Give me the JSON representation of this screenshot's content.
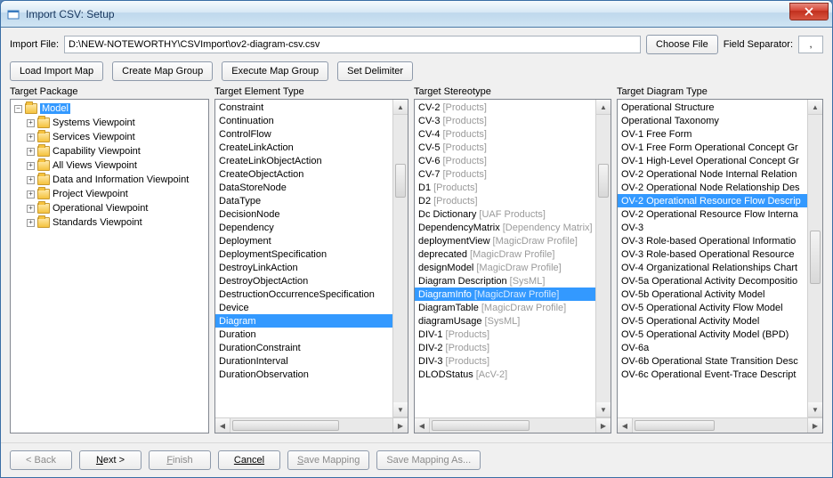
{
  "window": {
    "title": "Import CSV: Setup"
  },
  "import": {
    "label": "Import File:",
    "path": "D:\\NEW-NOTEWORTHY\\CSVImport\\ov2-diagram-csv.csv",
    "choose": "Choose File",
    "separator_label": "Field Separator:",
    "separator": ","
  },
  "buttons": {
    "load_map": "Load Import Map",
    "create_group": "Create Map Group",
    "exec_group": "Execute Map Group",
    "set_delim": "Set Delimiter"
  },
  "panels": {
    "p1": "Target Package",
    "p2": "Target Element Type",
    "p3": "Target Stereotype",
    "p4": "Target Diagram Type"
  },
  "tree": {
    "root": "Model",
    "children": [
      "Systems Viewpoint",
      "Services Viewpoint",
      "Capability Viewpoint",
      "All Views Viewpoint",
      "Data and Information Viewpoint",
      "Project Viewpoint",
      "Operational Viewpoint",
      "Standards Viewpoint"
    ]
  },
  "elementTypes": [
    "Constraint",
    "Continuation",
    "ControlFlow",
    "CreateLinkAction",
    "CreateLinkObjectAction",
    "CreateObjectAction",
    "DataStoreNode",
    "DataType",
    "DecisionNode",
    "Dependency",
    "Deployment",
    "DeploymentSpecification",
    "DestroyLinkAction",
    "DestroyObjectAction",
    "DestructionOccurrenceSpecification",
    "Device",
    "Diagram",
    "Duration",
    "DurationConstraint",
    "DurationInterval",
    "DurationObservation"
  ],
  "elementSelectedIndex": 16,
  "stereotypes": [
    {
      "label": "CV-2",
      "suffix": "[Products]"
    },
    {
      "label": "CV-3",
      "suffix": "[Products]"
    },
    {
      "label": "CV-4",
      "suffix": "[Products]"
    },
    {
      "label": "CV-5",
      "suffix": "[Products]"
    },
    {
      "label": "CV-6",
      "suffix": "[Products]"
    },
    {
      "label": "CV-7",
      "suffix": "[Products]"
    },
    {
      "label": "D1",
      "suffix": "[Products]"
    },
    {
      "label": "D2",
      "suffix": "[Products]"
    },
    {
      "label": "Dc Dictionary",
      "suffix": "[UAF Products]"
    },
    {
      "label": "DependencyMatrix",
      "suffix": "[Dependency Matrix]"
    },
    {
      "label": "deploymentView",
      "suffix": "[MagicDraw Profile]"
    },
    {
      "label": "deprecated",
      "suffix": "[MagicDraw Profile]"
    },
    {
      "label": "designModel",
      "suffix": "[MagicDraw Profile]"
    },
    {
      "label": "Diagram Description",
      "suffix": "[SysML]"
    },
    {
      "label": "DiagramInfo",
      "suffix": "[MagicDraw Profile]"
    },
    {
      "label": "DiagramTable",
      "suffix": "[MagicDraw Profile]"
    },
    {
      "label": "diagramUsage",
      "suffix": "[SysML]"
    },
    {
      "label": "DIV-1",
      "suffix": "[Products]"
    },
    {
      "label": "DIV-2",
      "suffix": "[Products]"
    },
    {
      "label": "DIV-3",
      "suffix": "[Products]"
    },
    {
      "label": "DLODStatus",
      "suffix": "[AcV-2]"
    }
  ],
  "stereoSelectedIndex": 14,
  "diagramTypes": [
    "Operational Structure",
    "Operational Taxonomy",
    "OV-1 Free Form",
    "OV-1 Free Form Operational Concept Gr",
    "OV-1 High-Level Operational Concept Gr",
    "OV-2 Operational Node Internal Relation",
    "OV-2 Operational Node Relationship Des",
    "OV-2 Operational Resource Flow Descrip",
    "OV-2 Operational Resource Flow Interna",
    "OV-3",
    "OV-3 Role-based Operational Informatio",
    "OV-3 Role-based Operational Resource",
    "OV-4 Organizational Relationships Chart",
    "OV-5a Operational Activity Decompositio",
    "OV-5b Operational Activity Model",
    "OV-5 Operational Activity Flow Model",
    "OV-5 Operational Activity Model",
    "OV-5 Operational Activity Model (BPD)",
    "OV-6a",
    "OV-6b Operational State Transition Desc",
    "OV-6c Operational Event-Trace Descript"
  ],
  "diagSelectedIndex": 7,
  "footer": {
    "back": "Back",
    "next": "Next",
    "finish": "Finish",
    "cancel": "Cancel",
    "save": "Save Mapping",
    "saveas": "Save Mapping As..."
  }
}
